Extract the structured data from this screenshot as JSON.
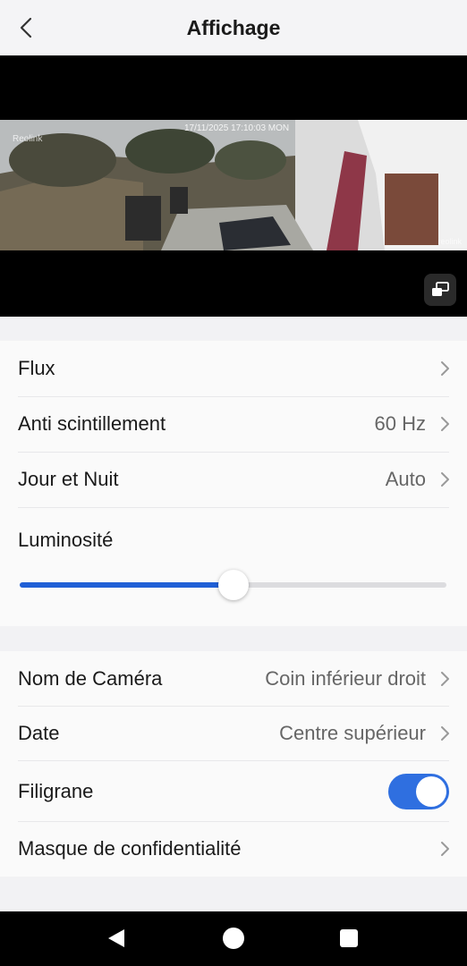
{
  "header": {
    "title": "Affichage"
  },
  "video": {
    "osd_camera_name": "Reolink",
    "osd_date": "17/11/2025 17:10:03 MON"
  },
  "display": {
    "flux": {
      "label": "Flux"
    },
    "anti_flicker": {
      "label": "Anti scintillement",
      "value": "60 Hz"
    },
    "day_night": {
      "label": "Jour et Nuit",
      "value": "Auto"
    },
    "brightness": {
      "label": "Luminosité",
      "level_percent": 50
    }
  },
  "osd": {
    "camera_name": {
      "label": "Nom de Caméra",
      "value": "Coin inférieur droit"
    },
    "date": {
      "label": "Date",
      "value": "Centre supérieur"
    },
    "watermark": {
      "label": "Filigrane",
      "enabled": true
    },
    "privacy_mask": {
      "label": "Masque de confidentialité"
    }
  },
  "colors": {
    "accent": "#1f5fd6",
    "toggle_on": "#2f6fe0"
  }
}
